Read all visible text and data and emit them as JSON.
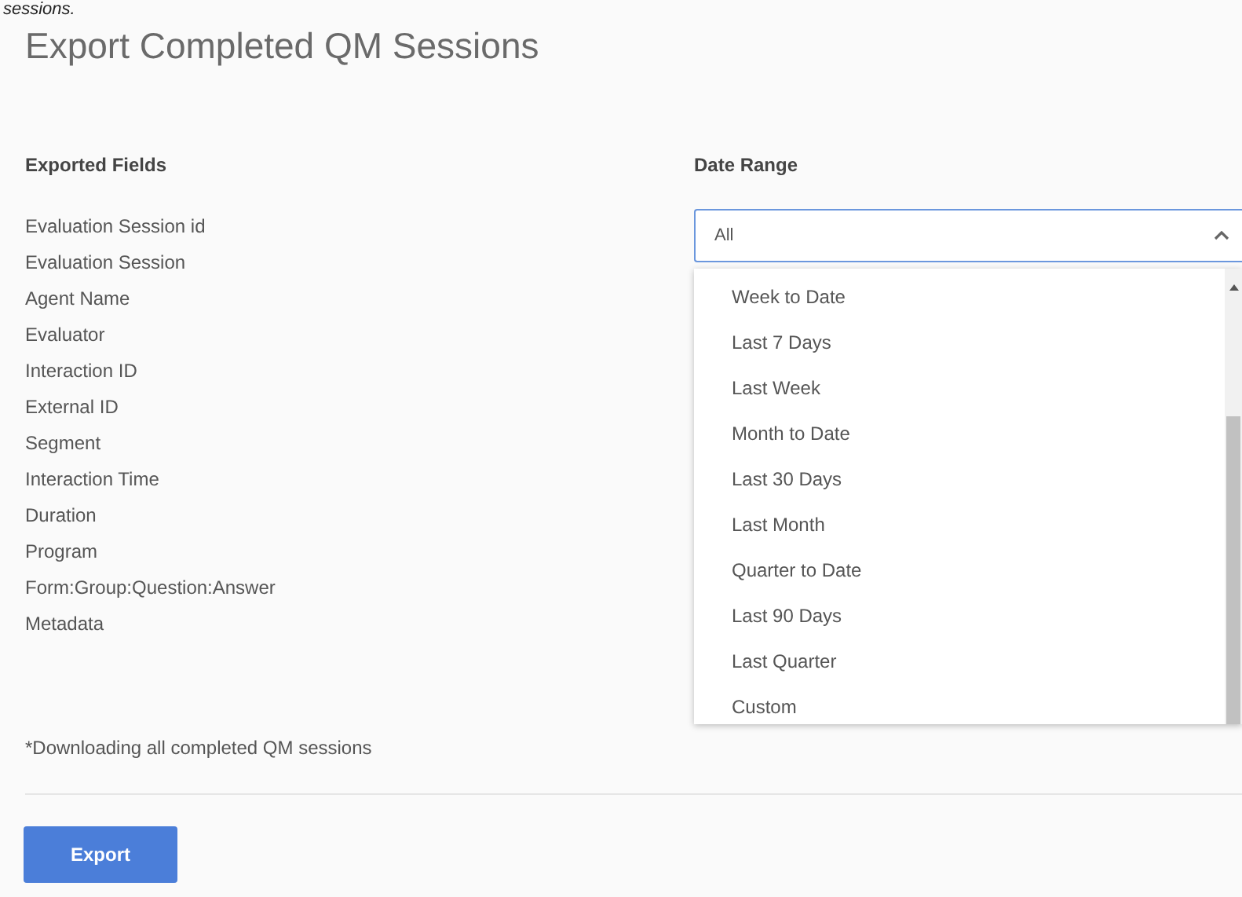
{
  "caption_fragment": "sessions.",
  "title": "Export Completed QM Sessions",
  "exported_fields": {
    "heading": "Exported Fields",
    "items": [
      "Evaluation Session id",
      "Evaluation Session",
      "Agent Name",
      "Evaluator",
      "Interaction ID",
      "External ID",
      "Segment",
      "Interaction Time",
      "Duration",
      "Program",
      "Form:Group:Question:Answer",
      "Metadata"
    ],
    "note": "*Downloading all completed QM sessions"
  },
  "date_range": {
    "heading": "Date Range",
    "value": "All",
    "expanded": true,
    "options": [
      "Week to Date",
      "Last 7 Days",
      "Last Week",
      "Month to Date",
      "Last 30 Days",
      "Last Month",
      "Quarter to Date",
      "Last 90 Days",
      "Last Quarter",
      "Custom"
    ]
  },
  "buttons": [
    "Export"
  ]
}
